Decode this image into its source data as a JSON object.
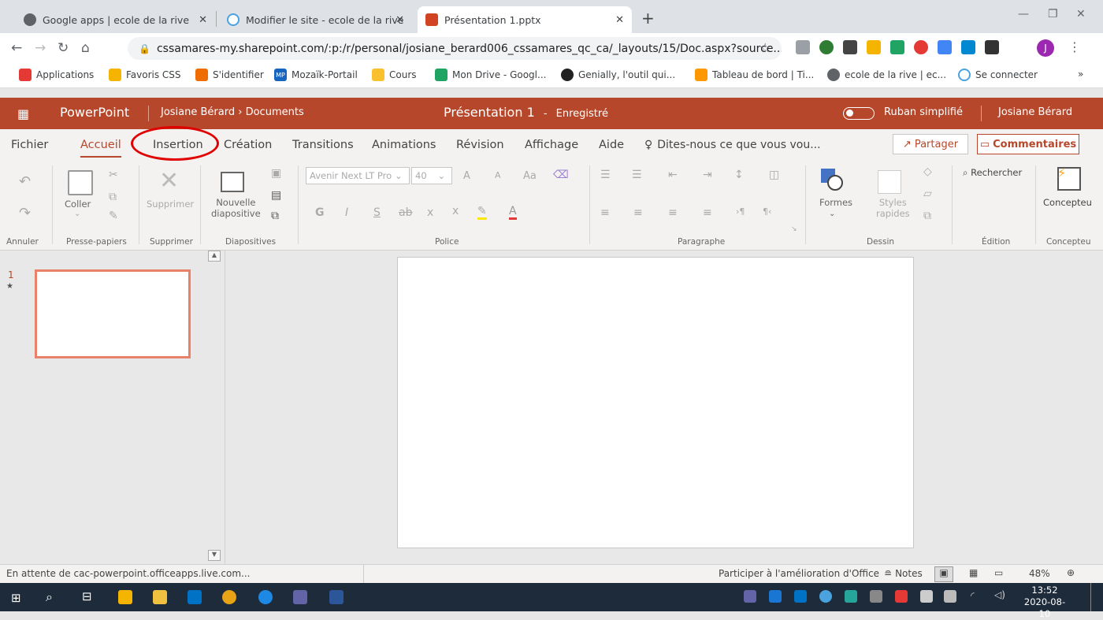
{
  "browser": {
    "tabs": [
      {
        "title": "Google apps | ecole de la rive",
        "icon": "globe-icon"
      },
      {
        "title": "Modifier le site - ecole de la rive",
        "icon": "sites-icon"
      },
      {
        "title": "Présentation 1.pptx",
        "icon": "powerpoint-icon"
      }
    ],
    "new_tab": "+",
    "url": "cssamares-my.sharepoint.com/:p:/r/personal/josiane_berard006_cssamares_qc_ca/_layouts/15/Doc.aspx?source...",
    "profile_initial": "J",
    "bookmarks": [
      "Applications",
      "Favoris CSS",
      "S'identifier",
      "Mozaïk-Portail",
      "Cours",
      "Mon Drive - Googl...",
      "Genially, l'outil qui...",
      "Tableau de bord | Ti...",
      "ecole de la rive | ec...",
      "Se connecter"
    ],
    "bookmarks_more": "»",
    "mp_badge": "MP"
  },
  "app": {
    "name": "PowerPoint",
    "breadcrumb_user": "Josiane Bérard",
    "breadcrumb_sep": "›",
    "breadcrumb_folder": "Documents",
    "doc_title": "Présentation 1",
    "doc_sep": "-",
    "save_status": "Enregistré",
    "simplified_ribbon": "Ruban simplifié",
    "user": "Josiane Bérard"
  },
  "menu": {
    "tabs": [
      "Fichier",
      "Accueil",
      "Insertion",
      "Création",
      "Transitions",
      "Animations",
      "Révision",
      "Affichage",
      "Aide"
    ],
    "selected": "Accueil",
    "tell_me": "Dites-nous ce que vous vou...",
    "share": "Partager",
    "comments": "Commentaires"
  },
  "ribbon": {
    "groups": [
      "Annuler",
      "Presse-papiers",
      "Supprimer",
      "Diapositives",
      "Police",
      "Paragraphe",
      "Dessin",
      "Édition",
      "Concepteu"
    ],
    "coller": "Coller",
    "supprimer": "Supprimer",
    "nouvelle": "Nouvelle",
    "diapositive": "diapositive",
    "font_name": "Avenir Next LT Pro",
    "font_size": "40",
    "formes": "Formes",
    "styles": "Styles",
    "rapides": "rapides",
    "rechercher": "Rechercher",
    "concepteur": "Concepteu",
    "grow": "A",
    "shrink": "A",
    "case": "Aa",
    "bold": "G",
    "italic": "I",
    "underline": "S",
    "strike": "ab",
    "sub": "x",
    "sup": "x"
  },
  "slides": [
    {
      "number": "1",
      "marker": "★"
    }
  ],
  "status": {
    "left": "En attente de cac-powerpoint.officeapps.live.com...",
    "help": "Participer à l'amélioration d'Office",
    "notes": "Notes",
    "zoom": "48%"
  },
  "taskbar": {
    "time": "13:52",
    "date": "2020-08-10"
  },
  "colors": {
    "brand": "#b7472a",
    "annotation": "#e00000"
  }
}
